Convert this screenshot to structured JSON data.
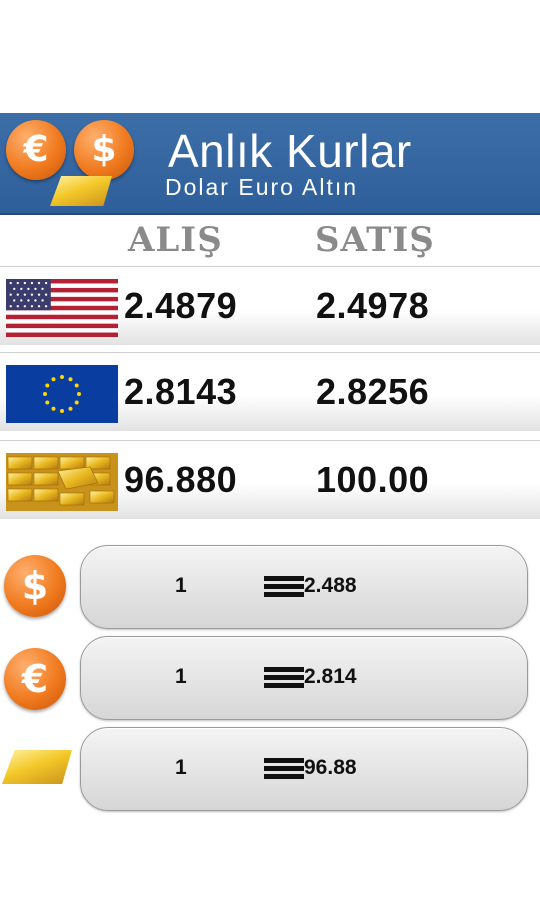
{
  "header": {
    "title": "Anlık Kurlar",
    "subtitle": "Dolar Euro Altın",
    "icons": [
      "euro-coin",
      "dollar-coin",
      "gold-bar"
    ]
  },
  "columns": {
    "buy": "ALIŞ",
    "sell": "SATIŞ"
  },
  "rates": [
    {
      "currency": "usd",
      "flag": "us-flag",
      "buy": "2.4879",
      "sell": "2.4978"
    },
    {
      "currency": "eur",
      "flag": "eu-flag",
      "buy": "2.8143",
      "sell": "2.8256"
    },
    {
      "currency": "gold",
      "flag": "gold-bars",
      "buy": "96.880",
      "sell": "100.00"
    }
  ],
  "converter": [
    {
      "icon": "dollar-coin",
      "symbol": "$",
      "amount": "1",
      "result": "2.488"
    },
    {
      "icon": "euro-coin",
      "symbol": "€",
      "amount": "1",
      "result": "2.814"
    },
    {
      "icon": "gold-bar",
      "symbol": "",
      "amount": "1",
      "result": "96.88"
    }
  ],
  "colors": {
    "banner": "#2f5f9a",
    "coin": "#f07a1e",
    "gold": "#f4c92a"
  }
}
